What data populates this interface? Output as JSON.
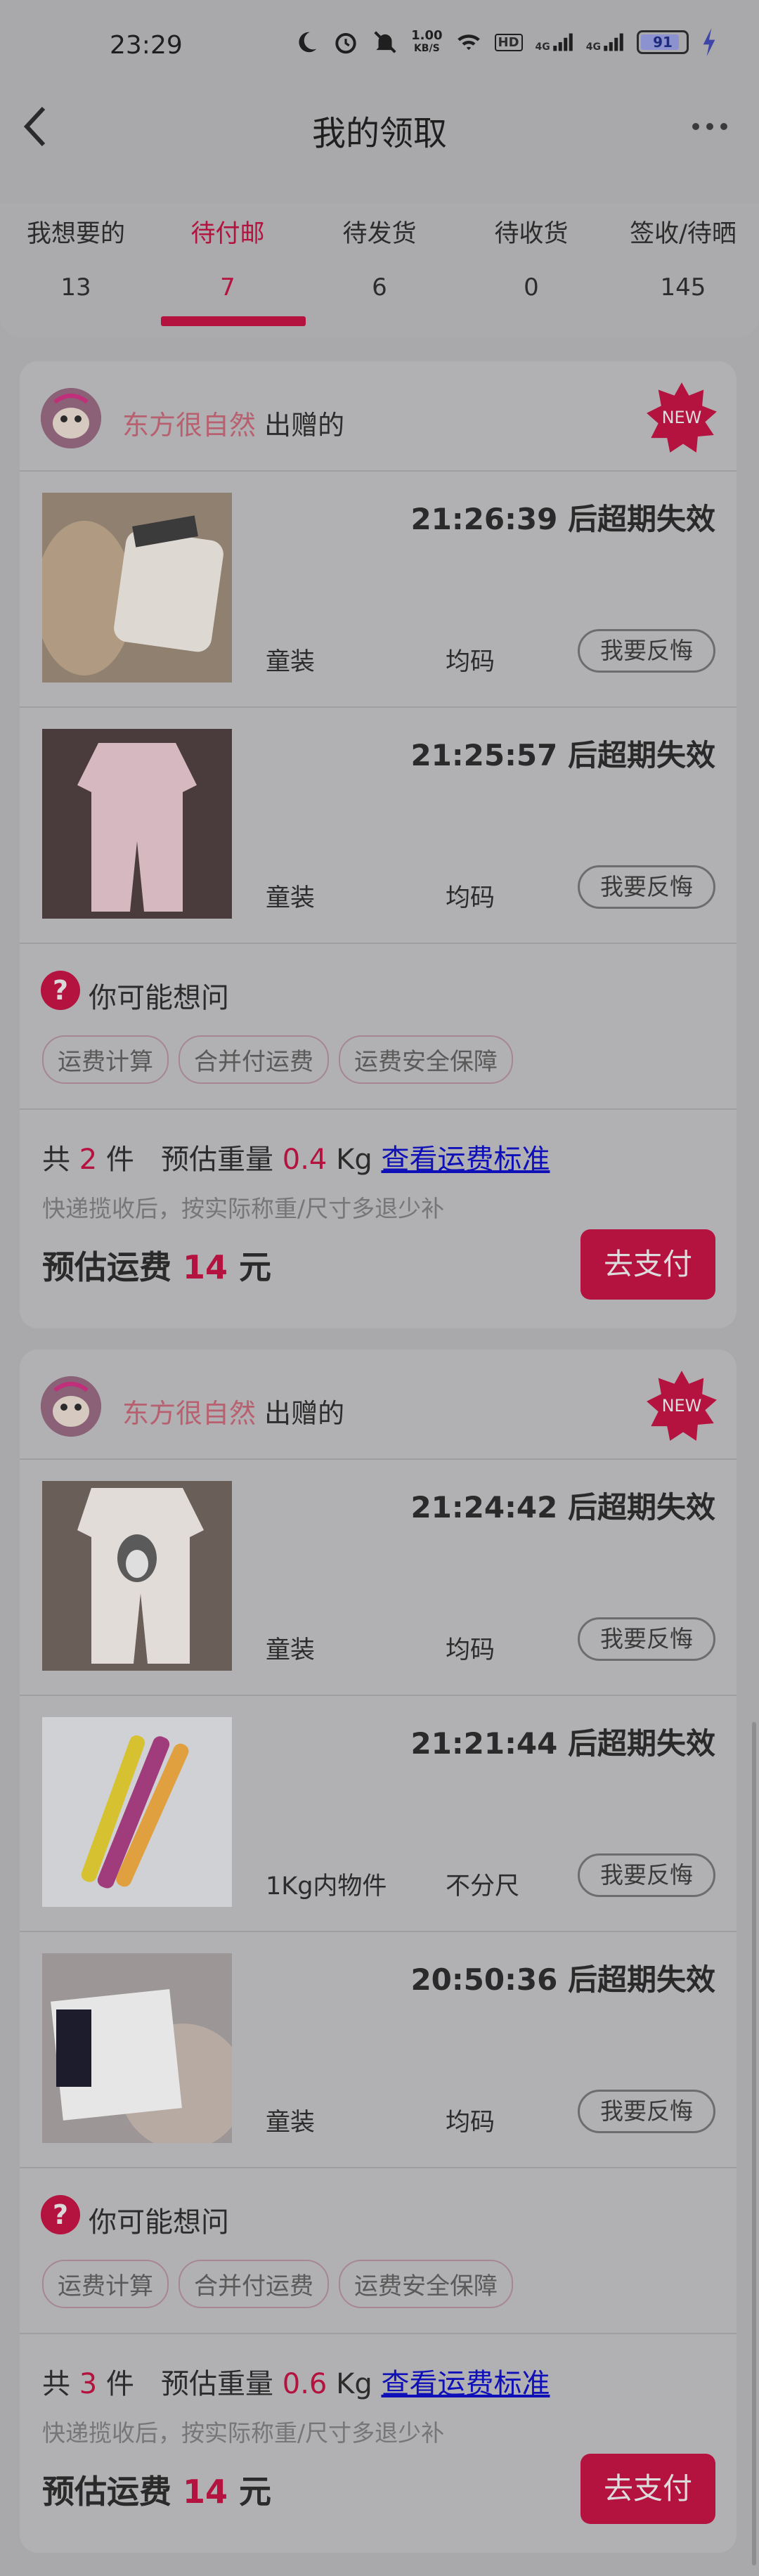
{
  "status_bar": {
    "time": "23:29",
    "net_speed_value": "1.00",
    "net_speed_unit": "KB/S",
    "hd": "HD",
    "sig1": "4G",
    "sig2": "4G",
    "battery": "91"
  },
  "nav": {
    "title": "我的领取"
  },
  "tabs": [
    {
      "label": "我想要的",
      "count": "13"
    },
    {
      "label": "待付邮",
      "count": "7"
    },
    {
      "label": "待发货",
      "count": "6"
    },
    {
      "label": "待收货",
      "count": "0"
    },
    {
      "label": "签收/待晒",
      "count": "145"
    }
  ],
  "active_tab": "待付邮",
  "colors": {
    "accent": "#b4123f",
    "background": "#a9a9ab",
    "card": "#b1b1b3",
    "link": "#1010b8"
  },
  "cards": [
    {
      "giver_name": "东方很自然",
      "giver_suffix": "出赠的",
      "badge": "NEW",
      "items": [
        {
          "deadline": "21:26:39 后超期失效",
          "category": "童装",
          "size": "均码",
          "action": "我要反悔"
        },
        {
          "deadline": "21:25:57 后超期失效",
          "category": "童装",
          "size": "均码",
          "action": "我要反悔"
        }
      ],
      "faq": {
        "title": "你可能想问",
        "chips": [
          "运费计算",
          "合并付运费",
          "运费安全保障"
        ]
      },
      "summary": {
        "count_prefix": "共",
        "count": "2",
        "count_suffix": "件",
        "weight_label": "预估重量",
        "weight": "0.4",
        "weight_unit": "Kg",
        "link": "查看运费标准",
        "note": "快递揽收后，按实际称重/尺寸多退少补",
        "fee_label": "预估运费",
        "fee": "14",
        "fee_unit": "元",
        "pay_button": "去支付"
      }
    },
    {
      "giver_name": "东方很自然",
      "giver_suffix": "出赠的",
      "badge": "NEW",
      "items": [
        {
          "deadline": "21:24:42 后超期失效",
          "category": "童装",
          "size": "均码",
          "action": "我要反悔"
        },
        {
          "deadline": "21:21:44 后超期失效",
          "category": "1Kg内物件",
          "size": "不分尺",
          "action": "我要反悔"
        },
        {
          "deadline": "20:50:36 后超期失效",
          "category": "童装",
          "size": "均码",
          "action": "我要反悔"
        }
      ],
      "faq": {
        "title": "你可能想问",
        "chips": [
          "运费计算",
          "合并付运费",
          "运费安全保障"
        ]
      },
      "summary": {
        "count_prefix": "共",
        "count": "3",
        "count_suffix": "件",
        "weight_label": "预估重量",
        "weight": "0.6",
        "weight_unit": "Kg",
        "link": "查看运费标准",
        "note": "快递揽收后，按实际称重/尺寸多退少补",
        "fee_label": "预估运费",
        "fee": "14",
        "fee_unit": "元",
        "pay_button": "去支付"
      }
    }
  ]
}
